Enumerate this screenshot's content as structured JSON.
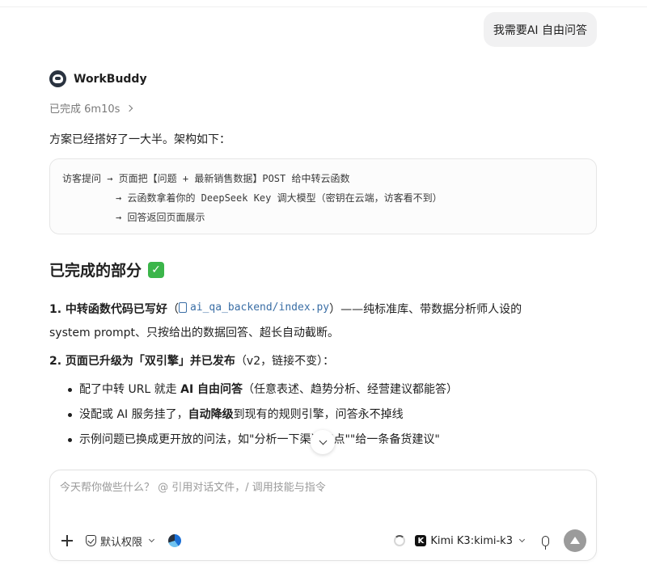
{
  "user_message": "我需要AI 自由问答",
  "agent": {
    "name": "WorkBuddy",
    "status": "已完成 6m10s"
  },
  "reply": {
    "intro": "方案已经搭好了一大半。架构如下：",
    "code_lines": [
      "访客提问 → 页面把【问题 + 最新销售数据】POST 给中转云函数",
      "→ 云函数拿着你的 DeepSeek Key 调大模型（密钥在云端，访客看不到）",
      "→ 回答返回页面展示"
    ],
    "section_title": "已完成的部分",
    "section_emoji": "✓",
    "item1": {
      "bold": "1. 中转函数代码已写好",
      "open_paren": "（",
      "file": "ai_qa_backend/index.py",
      "close_rest": "）——纯标准库、带数据分析师人设的",
      "line2": "system prompt、只按给出的数据回答、超长自动截断。"
    },
    "item2": {
      "bold": "2. 页面已升级为「双引擎」并已发布",
      "rest": "（v2，链接不变）："
    },
    "bullets": [
      {
        "pre": "配了中转 URL 就走 ",
        "bold": "AI 自由问答",
        "post": "（任意表述、趋势分析、经营建议都能答）"
      },
      {
        "pre": "没配或 AI 服务挂了，",
        "bold": "自动降级",
        "post": "到现有的规则引擎，问答永不掉线"
      },
      {
        "pre": "示例问题已换成更开放的问法，如\"分析一下",
        "bold": "",
        "post": "渠道特点\"\"给一条备货建议\""
      }
    ]
  },
  "composer": {
    "placeholder": "今天帮你做些什么？ @ 引用对话文件，/ 调用技能与指令",
    "permission_label": "默认权限",
    "model_label": "Kimi K3:kimi-k3",
    "kimi_letter": "K"
  },
  "icons": {
    "avatar": "workbuddy-avatar-icon",
    "status_chevron": "chevron-right-icon",
    "file": "file-icon",
    "scroll": "chevron-down-icon",
    "plus": "plus-icon",
    "shield": "shield-check-icon",
    "swirl": "swirl-logo-icon",
    "spinner": "spinner-icon",
    "mic": "microphone-icon",
    "send": "send-arrow-icon"
  },
  "colors": {
    "accent_link": "#3a6ea5",
    "check_green": "#3bb54a",
    "send_button": "#9b9b9b"
  }
}
